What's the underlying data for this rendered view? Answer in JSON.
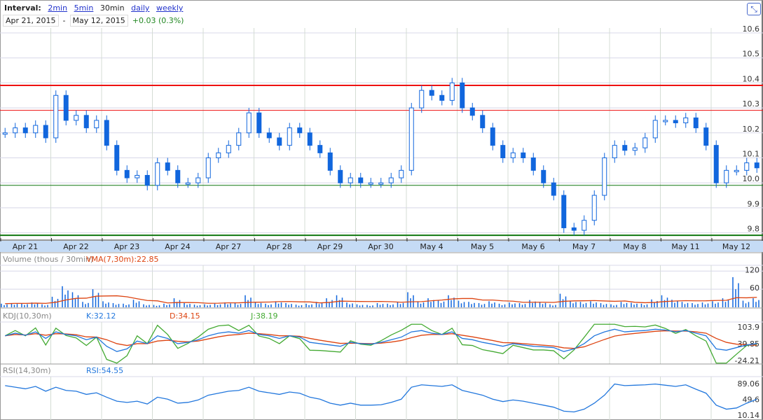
{
  "header": {
    "interval_label": "Interval:",
    "intervals": [
      "2min",
      "5min",
      "30min",
      "daily",
      "weekly"
    ],
    "current_interval": "30min",
    "start_date": "Apr 21, 2015",
    "end_date": "May 12, 2015",
    "separator": "-",
    "change": "+0.03 (0.3%)"
  },
  "colors": {
    "up": "#1166dd",
    "grid": "#d8d8e8",
    "day": "#d4dcd4",
    "resist": "#ee1111",
    "support": "#117711",
    "axisband": "#c5dbf5",
    "vma": "#dd4411",
    "k": "#2277dd",
    "d": "#dd4411",
    "j": "#44aa33"
  },
  "chart_data": {
    "type": "candlestick",
    "dates": [
      "Apr 21",
      "Apr 22",
      "Apr 23",
      "Apr 24",
      "Apr 27",
      "Apr 28",
      "Apr 29",
      "Apr 30",
      "May 4",
      "May 5",
      "May 6",
      "May 7",
      "May 8",
      "May 11",
      "May 12"
    ],
    "price_ticks": [
      10.6,
      10.5,
      10.4,
      10.3,
      10.2,
      10.1,
      10.0,
      9.9,
      9.8
    ],
    "ylim": [
      9.775,
      10.6
    ],
    "levels": {
      "resistance_strong": 10.39,
      "resistance": 10.29,
      "support": 9.99,
      "support_strong": 9.79
    },
    "close": [
      10.2,
      10.22,
      10.2,
      10.23,
      10.18,
      10.35,
      10.25,
      10.27,
      10.22,
      10.25,
      10.15,
      10.05,
      10.02,
      10.03,
      9.99,
      10.08,
      10.05,
      10.0,
      10.0,
      10.02,
      10.1,
      10.12,
      10.15,
      10.2,
      10.28,
      10.2,
      10.18,
      10.15,
      10.22,
      10.2,
      10.15,
      10.12,
      10.05,
      10.0,
      10.02,
      10.0,
      10.0,
      10.0,
      10.02,
      10.05,
      10.3,
      10.37,
      10.35,
      10.33,
      10.4,
      10.3,
      10.27,
      10.22,
      10.15,
      10.1,
      10.12,
      10.1,
      10.05,
      10.0,
      9.95,
      9.82,
      9.81,
      9.85,
      9.95,
      10.1,
      10.15,
      10.13,
      10.14,
      10.18,
      10.25,
      10.25,
      10.24,
      10.26,
      10.22,
      10.15,
      10.0,
      10.05,
      10.05,
      10.08,
      10.06
    ],
    "volume_title": "Volume (thous / 30min)",
    "vma_label": "VMA(7,30m):22.85",
    "volume_ticks": [
      120,
      60
    ],
    "vol_max": 130,
    "volume": [
      12,
      14,
      13,
      16,
      10,
      35,
      70,
      50,
      18,
      60,
      20,
      14,
      12,
      25,
      10,
      8,
      12,
      30,
      14,
      9,
      10,
      12,
      16,
      14,
      40,
      18,
      12,
      20,
      14,
      9,
      12,
      18,
      30,
      40,
      16,
      10,
      8,
      14,
      12,
      18,
      50,
      20,
      30,
      24,
      40,
      22,
      18,
      14,
      20,
      12,
      16,
      14,
      24,
      18,
      10,
      45,
      22,
      18,
      20,
      14,
      10,
      18,
      15,
      12,
      26,
      40,
      25,
      18,
      14,
      16,
      20,
      30,
      100,
      22,
      30
    ],
    "kdj_title": "KDJ(10,30m)",
    "k_label": "K:32.12",
    "d_label": "D:34.15",
    "j_label": "J:38.19",
    "kdj_ticks": [
      "103.9",
      "39.85",
      "-24.21"
    ],
    "kdj_range": [
      -24.21,
      103.9
    ],
    "k": [
      70,
      80,
      72,
      85,
      60,
      85,
      75,
      70,
      55,
      65,
      30,
      10,
      20,
      50,
      40,
      70,
      60,
      40,
      45,
      55,
      70,
      80,
      85,
      80,
      90,
      75,
      70,
      60,
      70,
      65,
      45,
      40,
      35,
      30,
      45,
      40,
      38,
      45,
      55,
      65,
      85,
      90,
      80,
      75,
      85,
      60,
      55,
      45,
      38,
      30,
      40,
      35,
      30,
      28,
      25,
      10,
      20,
      40,
      70,
      85,
      95,
      85,
      88,
      90,
      95,
      92,
      85,
      90,
      80,
      70,
      20,
      15,
      25,
      35,
      40
    ],
    "d": [
      70,
      75,
      73,
      78,
      72,
      78,
      77,
      74,
      66,
      65,
      55,
      40,
      33,
      40,
      40,
      50,
      53,
      49,
      47,
      50,
      58,
      66,
      72,
      75,
      80,
      78,
      75,
      70,
      70,
      68,
      60,
      53,
      47,
      41,
      42,
      41,
      40,
      42,
      46,
      52,
      63,
      72,
      75,
      75,
      78,
      72,
      66,
      59,
      52,
      44,
      43,
      40,
      37,
      34,
      31,
      24,
      22,
      28,
      42,
      56,
      69,
      75,
      79,
      83,
      87,
      89,
      88,
      88,
      85,
      80,
      60,
      45,
      38,
      36,
      34
    ],
    "j": [
      70,
      90,
      70,
      100,
      35,
      99,
      71,
      62,
      33,
      65,
      -20,
      -50,
      -6,
      70,
      40,
      110,
      75,
      22,
      41,
      65,
      95,
      108,
      111,
      90,
      110,
      69,
      60,
      40,
      70,
      59,
      15,
      14,
      11,
      8,
      51,
      38,
      34,
      51,
      73,
      91,
      129,
      126,
      90,
      75,
      99,
      36,
      33,
      17,
      10,
      2,
      34,
      25,
      16,
      16,
      13,
      -18,
      16,
      64,
      126,
      143,
      147,
      105,
      106,
      104,
      111,
      98,
      79,
      94,
      70,
      50,
      -60,
      -45,
      0,
      33,
      38
    ],
    "rsi_title": "RSI(14,30m)",
    "rsi_label": "RSI:54.55",
    "rsi_ticks": [
      "89.06",
      "49.6",
      "10.14"
    ],
    "rsi_range": [
      10.14,
      89.06
    ],
    "rsi": [
      84,
      80,
      76,
      82,
      70,
      80,
      72,
      70,
      62,
      66,
      55,
      45,
      42,
      45,
      38,
      55,
      50,
      40,
      42,
      48,
      60,
      65,
      70,
      72,
      80,
      70,
      66,
      62,
      68,
      65,
      55,
      50,
      40,
      35,
      40,
      35,
      35,
      36,
      42,
      50,
      80,
      86,
      84,
      82,
      86,
      72,
      66,
      60,
      50,
      44,
      48,
      45,
      40,
      35,
      30,
      20,
      18,
      25,
      40,
      60,
      88,
      84,
      85,
      86,
      88,
      85,
      82,
      86,
      75,
      65,
      35,
      25,
      28,
      40,
      50
    ]
  }
}
